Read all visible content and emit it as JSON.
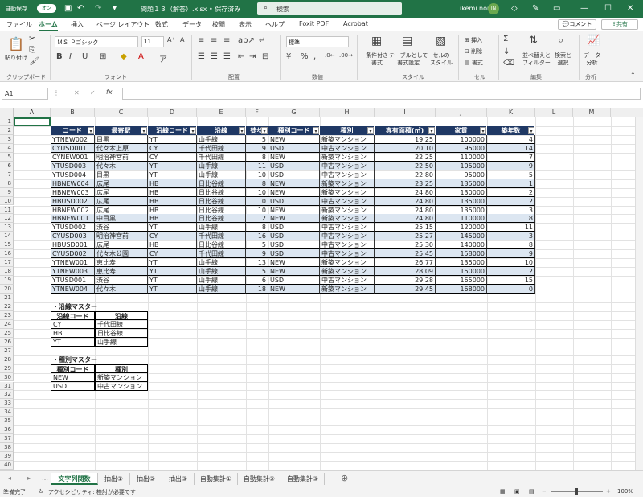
{
  "titlebar": {
    "autosave": "自動保存",
    "autosave_state": "オン",
    "filename": "問題１３（解答）.xlsx • 保存済み",
    "search": "検索",
    "user": "ikemi norie",
    "initials": "IN"
  },
  "menu": [
    "ファイル",
    "ホーム",
    "挿入",
    "ページ レイアウト",
    "数式",
    "データ",
    "校閲",
    "表示",
    "ヘルプ",
    "Foxit PDF",
    "Acrobat"
  ],
  "comment_btn": "コメント",
  "share_btn": "共有",
  "ribbon": {
    "clipboard": {
      "paste": "貼り付け",
      "label": "クリップボード"
    },
    "font": {
      "name": "ＭＳ Ｐゴシック",
      "size": "11",
      "label": "フォント"
    },
    "alignment": {
      "label": "配置"
    },
    "number": {
      "format": "標準",
      "label": "数値"
    },
    "styles": {
      "cond": "条件付き\n書式",
      "table": "テーブルとして\n書式設定",
      "cell": "セルの\nスタイル",
      "label": "スタイル"
    },
    "cells": {
      "insert": "挿入",
      "delete": "削除",
      "format": "書式",
      "label": "セル"
    },
    "editing": {
      "sort": "並べ替えと\nフィルター",
      "find": "検索と\n選択",
      "label": "編集"
    },
    "analysis": {
      "btn": "データ\n分析",
      "label": "分析"
    }
  },
  "namebox": "A1",
  "columns": [
    "A",
    "B",
    "C",
    "D",
    "E",
    "F",
    "G",
    "H",
    "I",
    "J",
    "K",
    "L",
    "M"
  ],
  "headers": [
    "コード",
    "最寄駅",
    "沿線コード",
    "沿線",
    "徒歩",
    "種別コード",
    "種別",
    "専有面積(㎡)",
    "家賃",
    "築年数"
  ],
  "rows": [
    [
      "YTNEW002",
      "目黒",
      "YT",
      "山手線",
      "5",
      "NEW",
      "新築マンション",
      "19.25",
      "100000",
      "4"
    ],
    [
      "CYUSD001",
      "代々木上原",
      "CY",
      "千代田線",
      "9",
      "USD",
      "中古マンション",
      "20.10",
      "95000",
      "14"
    ],
    [
      "CYNEW001",
      "明治神宮前",
      "CY",
      "千代田線",
      "8",
      "NEW",
      "新築マンション",
      "22.25",
      "110000",
      "7"
    ],
    [
      "YTUSD003",
      "代々木",
      "YT",
      "山手線",
      "11",
      "USD",
      "中古マンション",
      "22.50",
      "105000",
      "9"
    ],
    [
      "YTUSD004",
      "目黒",
      "YT",
      "山手線",
      "10",
      "USD",
      "中古マンション",
      "22.80",
      "95000",
      "5"
    ],
    [
      "HBNEW004",
      "広尾",
      "HB",
      "日比谷線",
      "8",
      "NEW",
      "新築マンション",
      "23.25",
      "135000",
      "1"
    ],
    [
      "HBNEW003",
      "広尾",
      "HB",
      "日比谷線",
      "10",
      "NEW",
      "新築マンション",
      "24.80",
      "130000",
      "2"
    ],
    [
      "HBUSD002",
      "広尾",
      "HB",
      "日比谷線",
      "10",
      "USD",
      "中古マンション",
      "24.80",
      "135000",
      "2"
    ],
    [
      "HBNEW002",
      "広尾",
      "HB",
      "日比谷線",
      "10",
      "NEW",
      "新築マンション",
      "24.80",
      "135000",
      "3"
    ],
    [
      "HBNEW001",
      "中目黒",
      "HB",
      "日比谷線",
      "12",
      "NEW",
      "新築マンション",
      "24.80",
      "110000",
      "8"
    ],
    [
      "YTUSD002",
      "渋谷",
      "YT",
      "山手線",
      "8",
      "USD",
      "中古マンション",
      "25.15",
      "120000",
      "11"
    ],
    [
      "CYUSD003",
      "明治神宮前",
      "CY",
      "千代田線",
      "16",
      "USD",
      "中古マンション",
      "25.27",
      "145000",
      "3"
    ],
    [
      "HBUSD001",
      "広尾",
      "HB",
      "日比谷線",
      "5",
      "USD",
      "中古マンション",
      "25.30",
      "140000",
      "8"
    ],
    [
      "CYUSD002",
      "代々木公園",
      "CY",
      "千代田線",
      "9",
      "USD",
      "中古マンション",
      "25.45",
      "158000",
      "9"
    ],
    [
      "YTNEW001",
      "恵比寿",
      "YT",
      "山手線",
      "13",
      "NEW",
      "新築マンション",
      "26.77",
      "135000",
      "10"
    ],
    [
      "YTNEW003",
      "恵比寿",
      "YT",
      "山手線",
      "15",
      "NEW",
      "新築マンション",
      "28.09",
      "150000",
      "2"
    ],
    [
      "YTUSD001",
      "渋谷",
      "YT",
      "山手線",
      "6",
      "USD",
      "中古マンション",
      "29.28",
      "165000",
      "15"
    ],
    [
      "YTNEW004",
      "代々木",
      "YT",
      "山手線",
      "18",
      "NEW",
      "新築マンション",
      "29.45",
      "168000",
      "0"
    ]
  ],
  "line_master": {
    "title": "・沿線マスター",
    "headers": [
      "沿線コード",
      "沿線"
    ],
    "rows": [
      [
        "CY",
        "千代田線"
      ],
      [
        "HB",
        "日比谷線"
      ],
      [
        "YT",
        "山手線"
      ]
    ]
  },
  "type_master": {
    "title": "・種別マスター",
    "headers": [
      "種別コード",
      "種別"
    ],
    "rows": [
      [
        "NEW",
        "新築マンション"
      ],
      [
        "USD",
        "中古マンション"
      ]
    ]
  },
  "sheets": [
    "文字列関数",
    "抽出①",
    "抽出②",
    "抽出③",
    "自動集計①",
    "自動集計②",
    "自動集計③"
  ],
  "status": {
    "ready": "準備完了",
    "accessibility": "アクセシビリティ: 検討が必要です",
    "zoom": "100%"
  }
}
